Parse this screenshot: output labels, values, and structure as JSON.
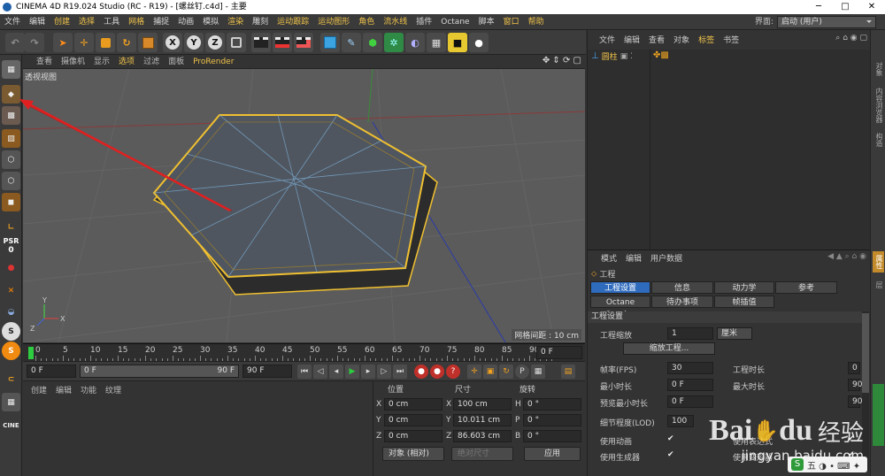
{
  "window": {
    "title": "CINEMA 4D R19.024 Studio (RC - R19) - [螺丝钉.c4d] - 主要",
    "minimize": "─",
    "maximize": "□",
    "close": "✕"
  },
  "menubar": {
    "items": [
      "文件",
      "编辑",
      "创建",
      "选择",
      "工具",
      "网格",
      "捕捉",
      "动画",
      "模拟",
      "渲染",
      "雕刻",
      "运动跟踪",
      "运动图形",
      "角色",
      "流水线",
      "插件",
      "Octane",
      "脚本",
      "窗口",
      "帮助"
    ],
    "interface_label": "界面:",
    "interface_value": "启动 (用户)"
  },
  "toolbar": {
    "axis_labels": [
      "X",
      "Y",
      "Z"
    ]
  },
  "left_toolbar": {
    "psr_label": "PSR",
    "psr_value": "0"
  },
  "viewport": {
    "menu": [
      "查看",
      "摄像机",
      "显示",
      "选项",
      "过滤",
      "面板",
      "ProRender"
    ],
    "label": "透视视图",
    "grid_readout": "网格间距 : 10 cm"
  },
  "timeline": {
    "ticks": [
      "0",
      "5",
      "10",
      "15",
      "20",
      "25",
      "30",
      "35",
      "40",
      "45",
      "50",
      "55",
      "60",
      "65",
      "70",
      "75",
      "80",
      "85",
      "90"
    ],
    "end_field": "0 F"
  },
  "transport": {
    "start": "0 F",
    "current": "0 F",
    "range_end": "90 F",
    "end": "90 F"
  },
  "material_panel": {
    "menu": [
      "创建",
      "编辑",
      "功能",
      "纹理"
    ]
  },
  "coordinates": {
    "headers": [
      "位置",
      "尺寸",
      "旋转"
    ],
    "rows": [
      {
        "axis": "X",
        "pos": "0 cm",
        "size": "100 cm",
        "rot_axis": "H",
        "rot": "0 °"
      },
      {
        "axis": "Y",
        "pos": "0 cm",
        "size": "10.011 cm",
        "rot_axis": "P",
        "rot": "0 °"
      },
      {
        "axis": "Z",
        "pos": "0 cm",
        "size": "86.603 cm",
        "rot_axis": "B",
        "rot": "0 °"
      }
    ],
    "mode": "对象 (相对)",
    "size_mode": "绝对尺寸",
    "apply": "应用"
  },
  "object_manager": {
    "menu": [
      "文件",
      "编辑",
      "查看",
      "对象",
      "标签",
      "书签"
    ],
    "objects": [
      {
        "name": "圆柱"
      }
    ]
  },
  "attributes": {
    "menu": [
      "模式",
      "编辑",
      "用户数据"
    ],
    "object": "工程",
    "tabs_row1": [
      "工程设置",
      "信息",
      "动力学",
      "参考"
    ],
    "tabs_row2": [
      "Octane Render",
      "待办事项",
      "帧插值"
    ],
    "section": "工程设置",
    "scale_label": "工程缩放",
    "scale_value": "1",
    "scale_unit": "厘米",
    "scale_button": "缩放工程...",
    "fps_label": "帧率(FPS)",
    "fps_value": "30",
    "project_time_label": "工程时长",
    "project_time_value": "0",
    "min_time_label": "最小时长",
    "min_time_value": "0 F",
    "max_time_label": "最大时长",
    "max_time_value": "90",
    "preview_min_label": "预览最小时长",
    "preview_min_value": "0 F",
    "preview_max_value": "90",
    "lod_label": "细节程度(LOD)",
    "lod_value": "100",
    "use_anim_label": "使用动画",
    "use_expr_label": "使用表达式",
    "use_gen_label": "使用生成器",
    "use_deform_label": "使用变形器"
  },
  "right_tabs": [
    "对象",
    "内容浏览器",
    "构造",
    "属性",
    "层"
  ],
  "watermark": {
    "brand": "Bai",
    "brand2": "du",
    "cn": "经验",
    "url": "jingyan.baidu.com"
  }
}
